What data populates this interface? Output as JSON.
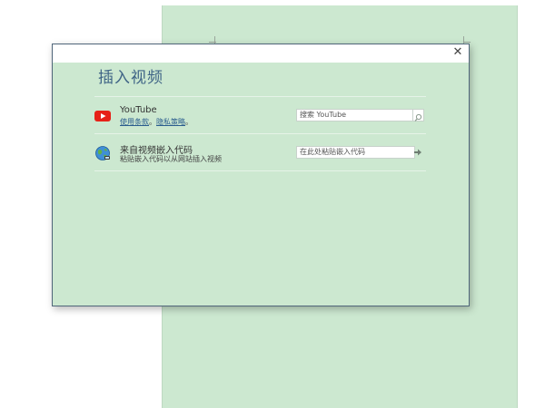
{
  "dialog": {
    "title": "插入视频",
    "close_icon": "close-icon"
  },
  "youtube": {
    "title": "YouTube",
    "terms_link": "使用条款",
    "separator_1": "。",
    "privacy_link": "隐私策略",
    "separator_2": "。",
    "search_placeholder": "搜索 YouTube",
    "icon": "youtube-icon",
    "search_icon": "search-icon",
    "brand_color": "#e62117"
  },
  "embed": {
    "title": "来自视频嵌入代码",
    "subtitle": "粘贴嵌入代码以从网站插入视频",
    "input_placeholder": "在此处粘贴嵌入代码",
    "icon": "globe-icon",
    "submit_icon": "arrow-right-icon"
  },
  "colors": {
    "background": "#cce8d0",
    "title": "#3f6486",
    "link": "#2a5d8e"
  }
}
